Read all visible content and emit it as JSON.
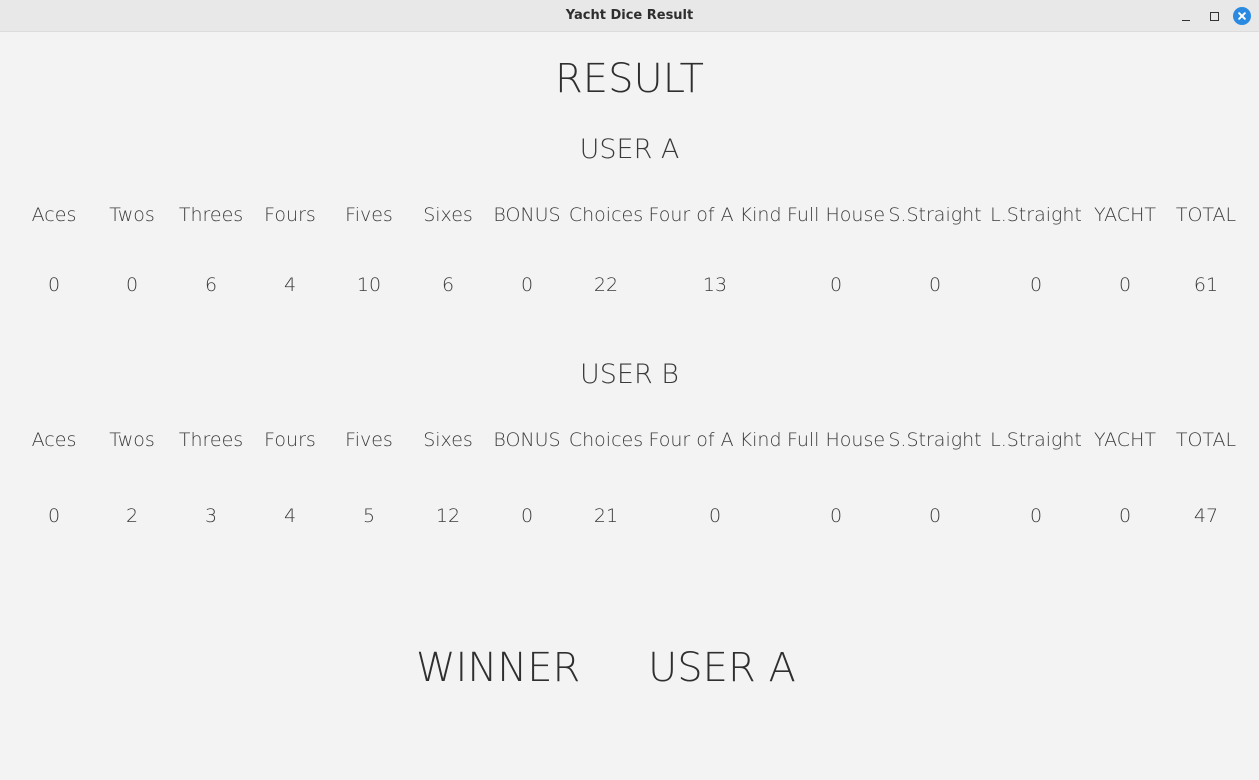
{
  "window": {
    "title": "Yacht Dice Result",
    "controls": [
      "minimize-icon",
      "maximize-icon",
      "close-icon"
    ],
    "close_color": "#2a8ae2"
  },
  "heading": "RESULT",
  "columns": [
    "Aces",
    "Twos",
    "Threes",
    "Fours",
    "Fives",
    "Sixes",
    "BONUS",
    "Choices",
    "Four of A Kind",
    "Full House",
    "S.Straight",
    "L.Straight",
    "YACHT",
    "TOTAL"
  ],
  "users": [
    {
      "name": "USER A",
      "scores": [
        "0",
        "0",
        "6",
        "4",
        "10",
        "6",
        "0",
        "22",
        "13",
        "0",
        "0",
        "0",
        "0",
        "61"
      ]
    },
    {
      "name": "USER B",
      "scores": [
        "0",
        "2",
        "3",
        "4",
        "5",
        "12",
        "0",
        "21",
        "0",
        "0",
        "0",
        "0",
        "0",
        "47"
      ]
    }
  ],
  "winner": {
    "label": "WINNER",
    "name": "USER A"
  }
}
